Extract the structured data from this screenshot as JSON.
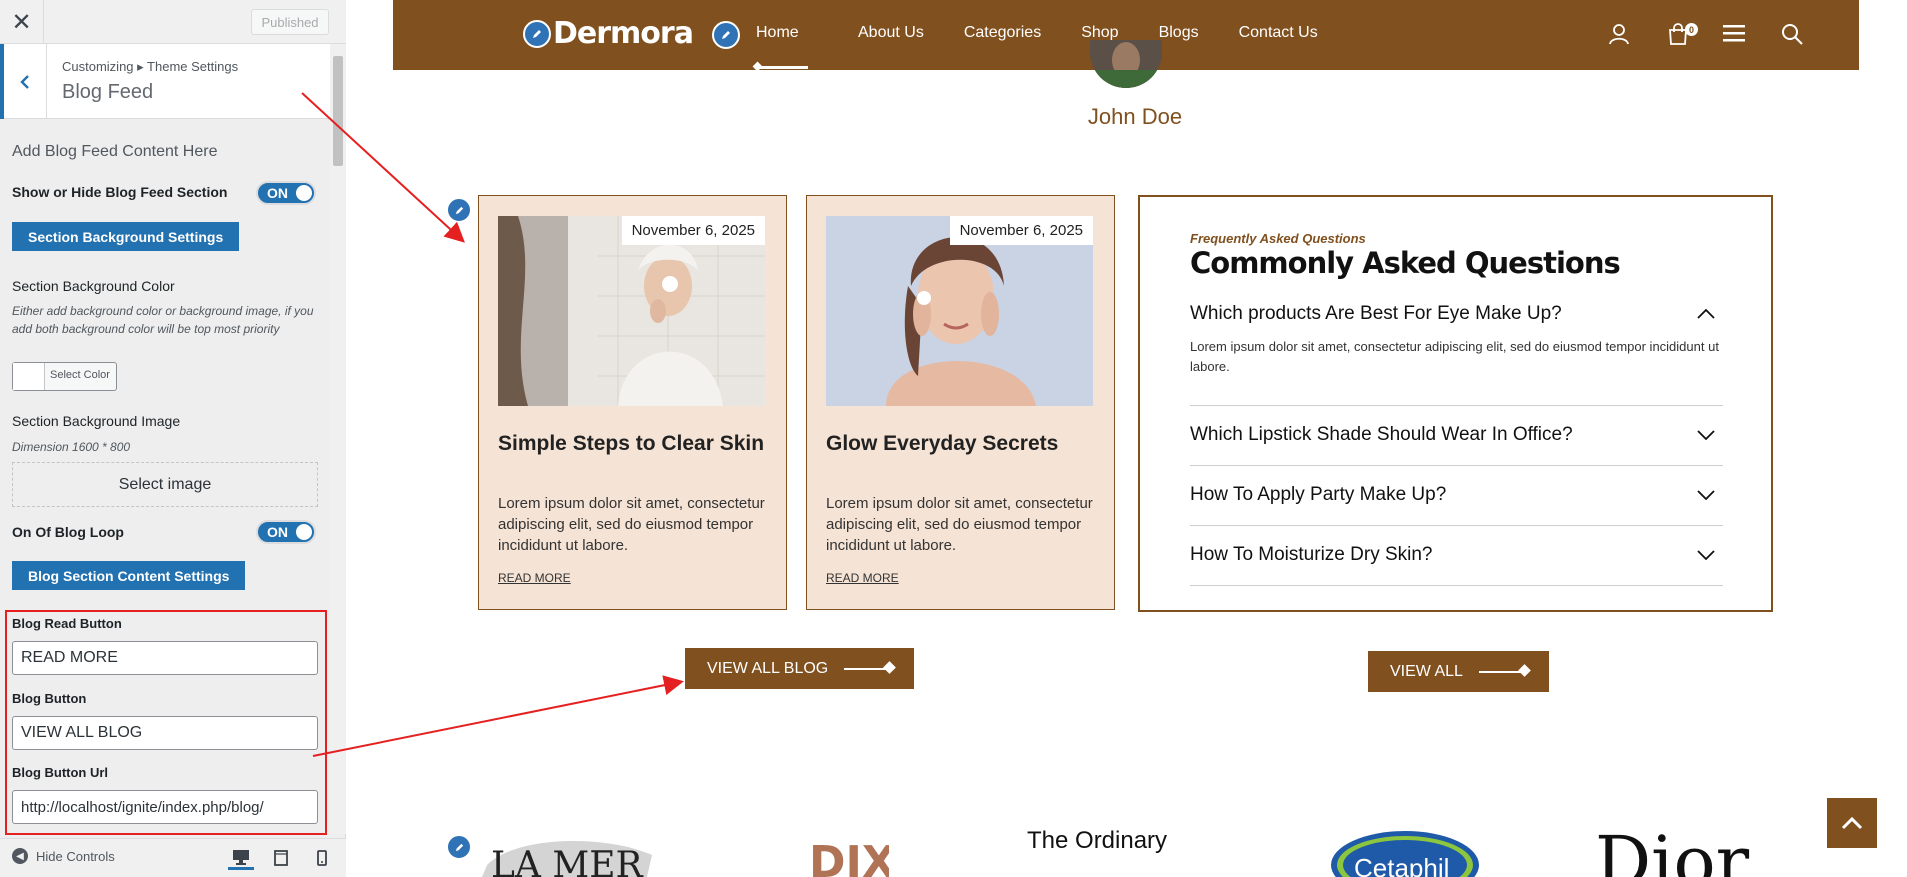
{
  "customizer": {
    "close_icon": "close-icon",
    "published_label": "Published",
    "breadcrumb": "Customizing ▸ Theme Settings",
    "section_title": "Blog Feed",
    "intro": "Add Blog Feed Content Here",
    "show_hide_label": "Show or Hide Blog Feed Section",
    "show_hide_toggle": "ON",
    "bg_settings_button": "Section Background Settings",
    "bg_color_label": "Section Background Color",
    "bg_color_desc": "Either add background color or background image, if you add both background color will be top most priority",
    "select_color_label": "Select Color",
    "bg_image_label": "Section Background Image",
    "bg_image_dimension": "Dimension 1600 * 800",
    "select_image_label": "Select image",
    "blog_loop_label": "On Of Blog Loop",
    "blog_loop_toggle": "ON",
    "content_settings_button": "Blog Section Content Settings",
    "read_button_label": "Blog Read Button",
    "read_button_value": "READ MORE",
    "blog_button_label": "Blog Button",
    "blog_button_value": "VIEW ALL BLOG",
    "blog_button_url_label": "Blog Button Url",
    "blog_button_url_value": "http://localhost/ignite/index.php/blog/",
    "hide_controls_label": "Hide Controls"
  },
  "site": {
    "brand_name": "Dermora",
    "nav": [
      "Home",
      "About Us",
      "Categories",
      "Shop",
      "Blogs",
      "Contact Us"
    ],
    "active_nav": "Home",
    "cart_count": "0",
    "accent_color": "#81501f",
    "edit_color": "#2f73b6"
  },
  "testimonial": {
    "name": "John Doe"
  },
  "blog_cards": [
    {
      "date": "November 6, 2025",
      "title": "Simple Steps to Clear Skin",
      "excerpt": "Lorem ipsum dolor sit amet, consectetur adipiscing elit, sed do eiusmod tempor incididunt ut labore.",
      "read_more": "READ MORE"
    },
    {
      "date": "November 6, 2025",
      "title": "Glow Everyday Secrets",
      "excerpt": "Lorem ipsum dolor sit amet, consectetur adipiscing elit, sed do eiusmod tempor incididunt ut labore.",
      "read_more": "READ MORE"
    }
  ],
  "faq": {
    "subtitle": "Frequently Asked Questions",
    "title": "Commonly Asked Questions",
    "items": [
      {
        "q": "Which products Are Best For Eye Make Up?",
        "a": "Lorem ipsum dolor sit amet, consectetur adipiscing elit, sed do eiusmod tempor incididunt ut labore.",
        "open": true
      },
      {
        "q": "Which Lipstick Shade Should Wear In Office?",
        "open": false
      },
      {
        "q": "How To Apply Party Make Up?",
        "open": false
      },
      {
        "q": "How To Moisturize Dry Skin?",
        "open": false
      }
    ]
  },
  "buttons": {
    "view_all_blog": "VIEW ALL BLOG",
    "view_all": "VIEW ALL"
  },
  "brands": [
    "LA MER",
    "DIXI",
    "The Ordinary",
    "Cetaphil",
    "Dior"
  ]
}
